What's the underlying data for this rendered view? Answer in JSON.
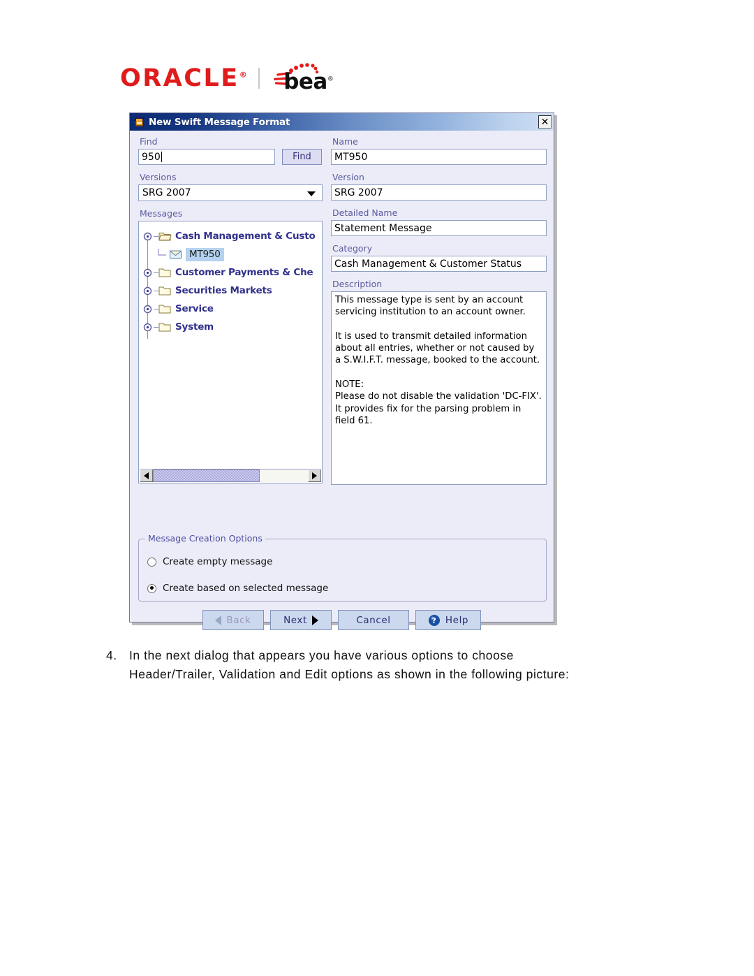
{
  "logo": {
    "oracle_text": "ORACLE",
    "oracle_mark": "®",
    "bea_text": "bea",
    "bea_mark": "®"
  },
  "dialog": {
    "title": "New Swift Message Format",
    "title_icon": "java-coffee-cup-icon",
    "close_label": "✕",
    "left": {
      "find_label": "Find",
      "find_value": "950",
      "find_button": "Find",
      "versions_label": "Versions",
      "versions_value": "SRG 2007",
      "messages_label": "Messages",
      "tree": [
        {
          "label": "Cash Management & Custo",
          "type": "folder-open",
          "expanded": true,
          "level": 0
        },
        {
          "label": "MT950",
          "type": "message",
          "selected": true,
          "level": 1
        },
        {
          "label": "Customer Payments & Che",
          "type": "folder",
          "expanded": false,
          "level": 0
        },
        {
          "label": "Securities Markets",
          "type": "folder",
          "expanded": false,
          "level": 0
        },
        {
          "label": "Service",
          "type": "folder",
          "expanded": false,
          "level": 0
        },
        {
          "label": "System",
          "type": "folder",
          "expanded": false,
          "level": 0
        }
      ]
    },
    "right": {
      "name_label": "Name",
      "name_value": "MT950",
      "version_label": "Version",
      "version_value": "SRG 2007",
      "detailed_name_label": "Detailed Name",
      "detailed_name_value": "Statement Message",
      "category_label": "Category",
      "category_value": "Cash Management & Customer Status",
      "description_label": "Description",
      "description_value": "This message type is sent by an account servicing institution to an account owner.\n\nIt is used to transmit detailed information about all entries, whether or not caused by a S.W.I.F.T. message, booked to the account.\n\nNOTE:\nPlease do not disable the validation 'DC-FIX'. It provides fix for the parsing problem in field 61."
    },
    "options": {
      "group_title": "Message Creation Options",
      "option_empty": "Create empty message",
      "option_based_on": "Create based on selected message",
      "selected": "option_based_on"
    },
    "buttons": {
      "back": "Back",
      "next": "Next",
      "cancel": "Cancel",
      "help": "Help"
    }
  },
  "page": {
    "step_number": "4.",
    "step_line1": "In the next dialog that appears you have various options to choose",
    "step_line2": "Header/Trailer, Validation and Edit options as shown in the following picture:"
  },
  "colors": {
    "title_bar_dark": "#0b2a73",
    "title_bar_light": "#cfe0f4",
    "dialog_bg": "#ececf8",
    "label_purple": "#5b5b9e",
    "tree_label": "#31318c",
    "selection_blue": "#b4d2ef",
    "button_face": "#ccd8ee",
    "oracle_red": "#e01b1b"
  }
}
